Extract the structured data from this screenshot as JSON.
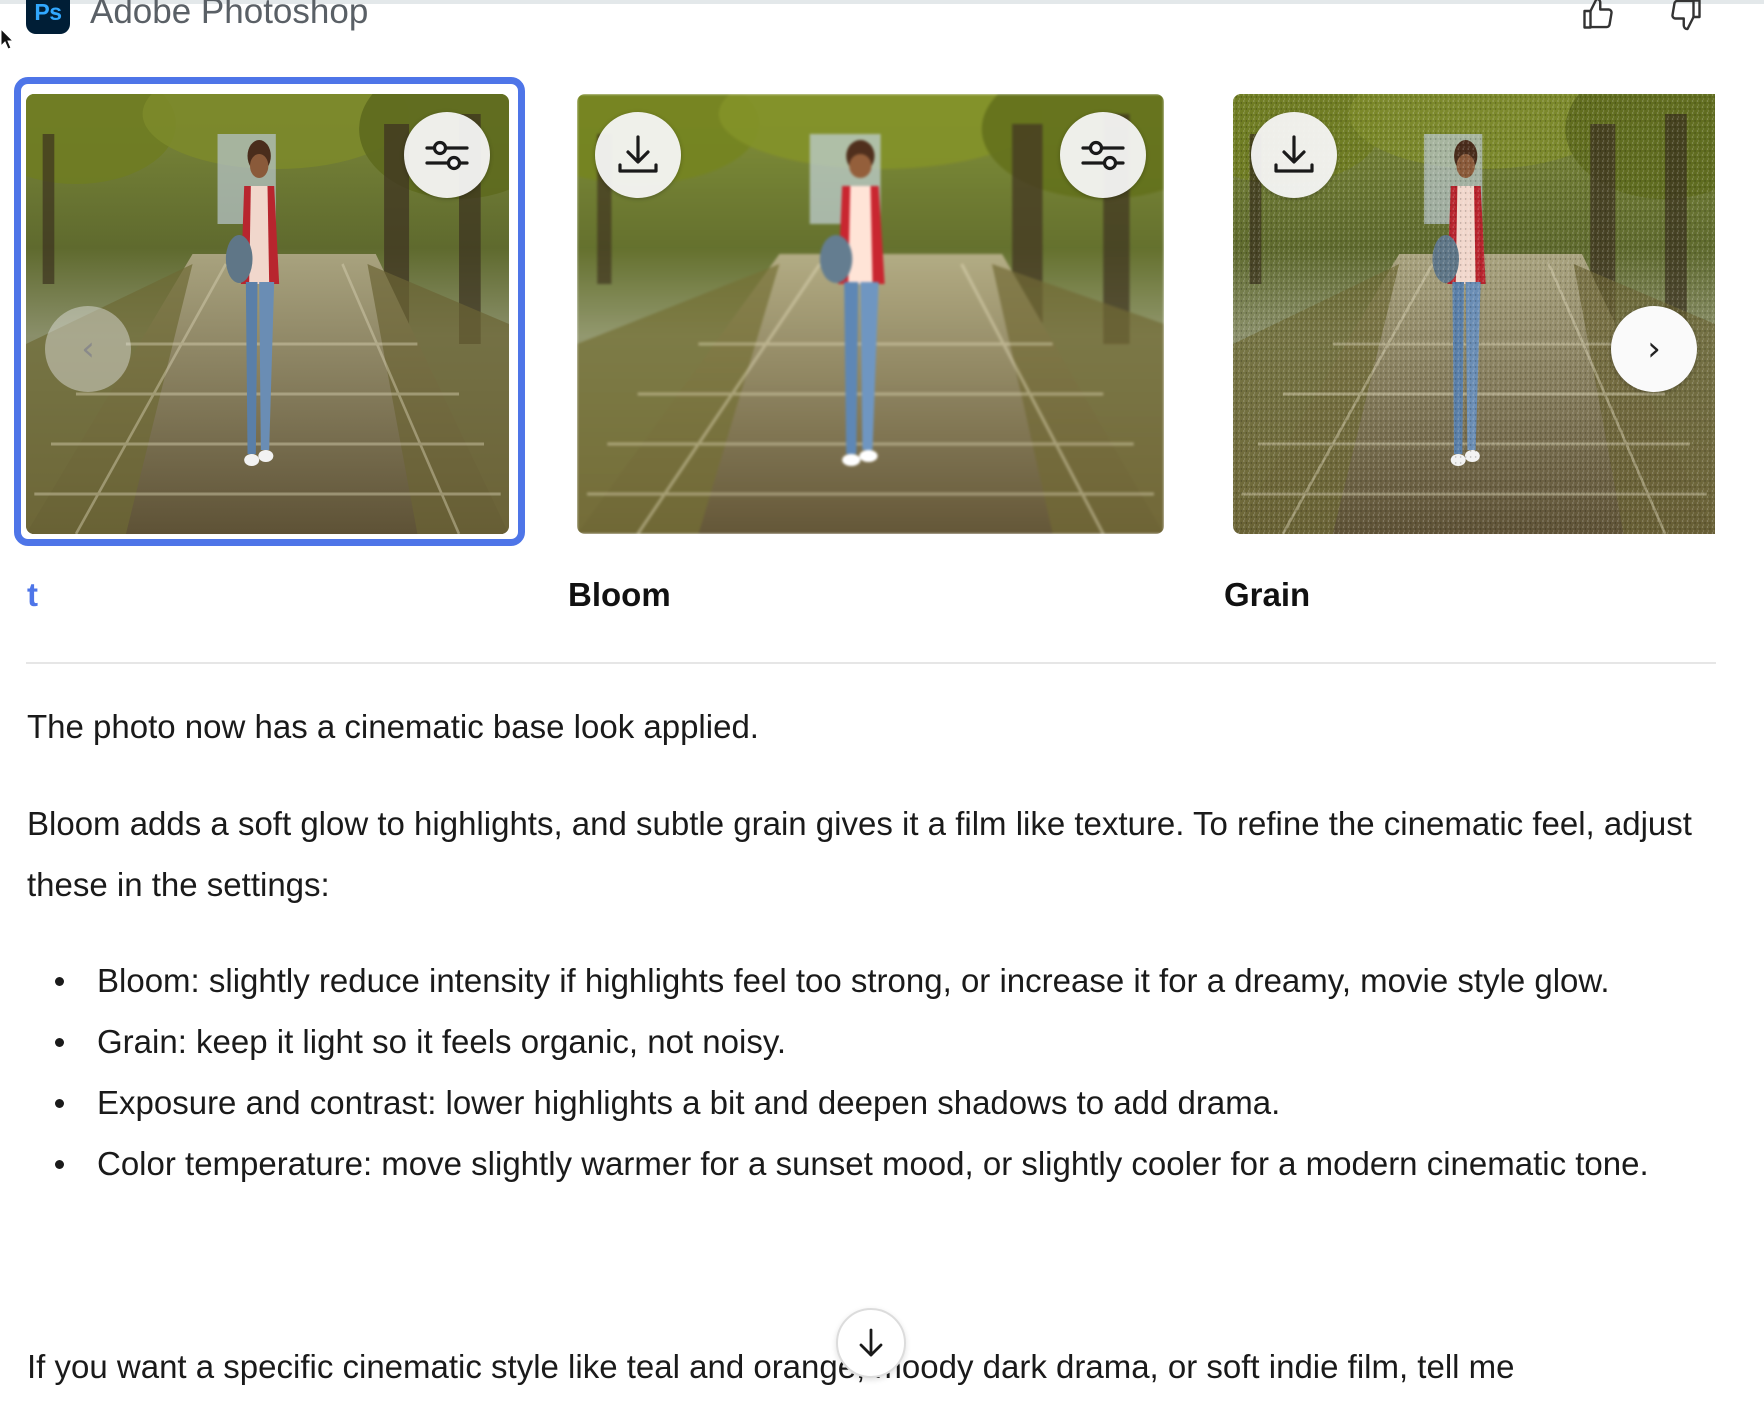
{
  "header": {
    "app_badge": "Ps",
    "app_name": "Adobe Photoshop",
    "icons": [
      "photoshop-logo-icon",
      "thumbs-up-icon",
      "thumbs-down-icon"
    ]
  },
  "carousel": {
    "cards": [
      {
        "label": "t",
        "selected": true,
        "has_download": false,
        "has_adjust": true,
        "effect": "base"
      },
      {
        "label": "Bloom",
        "selected": false,
        "has_download": true,
        "has_adjust": true,
        "effect": "bloom"
      },
      {
        "label": "Grain",
        "selected": false,
        "has_download": true,
        "has_adjust": false,
        "effect": "grain"
      }
    ],
    "prev_symbol": "‹",
    "next_symbol": "›",
    "accent_color": "#4e75e8"
  },
  "message": {
    "p1": "The photo now has a cinematic base look applied.",
    "p2": "Bloom adds a soft glow to highlights, and subtle grain gives it a film like texture. To refine the cinematic feel, adjust these in the settings:",
    "bullets": [
      "Bloom: slightly reduce intensity if highlights feel too strong, or increase it for a dreamy, movie style glow.",
      "Grain: keep it light so it feels organic, not noisy.",
      "Exposure and contrast: lower highlights a bit and deepen shadows to add drama.",
      "Color temperature: move slightly warmer for a sunset mood, or slightly cooler for a modern cinematic tone."
    ],
    "p3": "If you want a specific cinematic style like teal and orange, moody dark drama, or soft indie film, tell me"
  }
}
